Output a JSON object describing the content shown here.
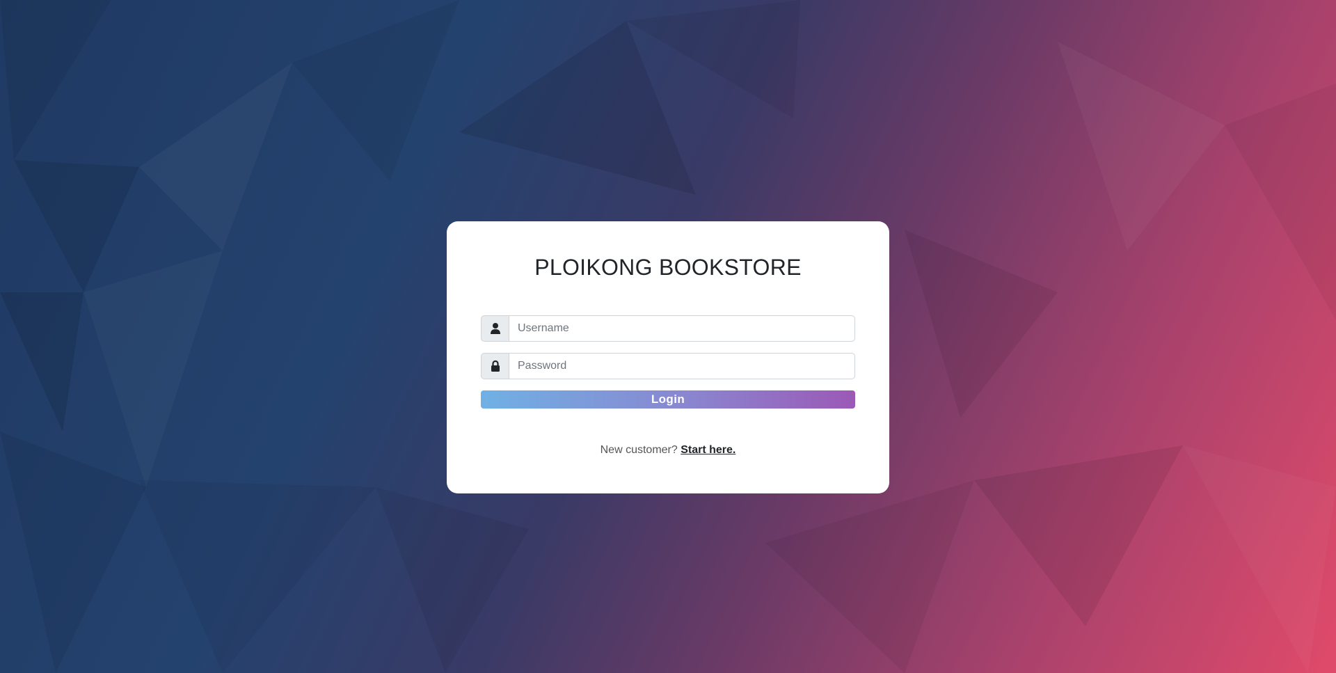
{
  "brand": {
    "title": "PLOIKONG BOOKSTORE"
  },
  "login_form": {
    "username": {
      "placeholder": "Username",
      "value": "",
      "icon": "user-icon"
    },
    "password": {
      "placeholder": "Password",
      "value": "",
      "icon": "lock-icon"
    },
    "submit_label": "Login"
  },
  "signup_prompt": {
    "text": "New customer?",
    "link_label": "Start here."
  },
  "colors": {
    "background_left": "#1f3a63",
    "background_right": "#e04a6a",
    "button_gradient_start": "#6fb1e4",
    "button_gradient_end": "#9b59b6",
    "card": "#ffffff"
  }
}
